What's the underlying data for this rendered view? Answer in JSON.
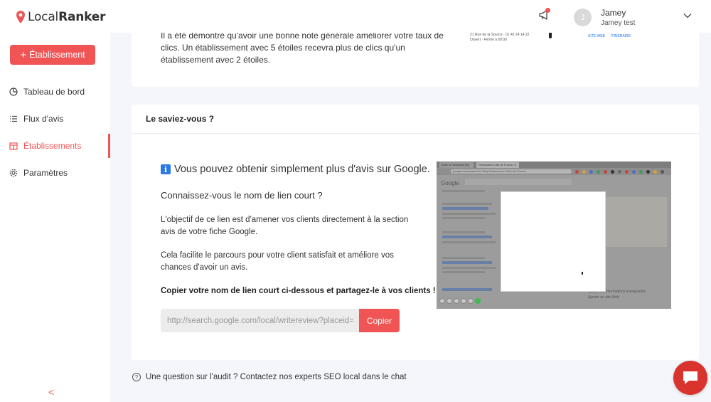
{
  "app": {
    "logo_text_light": "Local",
    "logo_text_bold": "Ranker",
    "brand_color": "#f05454"
  },
  "sidebar": {
    "add_button_label": "Établissement",
    "items": [
      {
        "label": "Tableau de bord",
        "icon": "pie-chart-icon",
        "active": false
      },
      {
        "label": "Flux d'avis",
        "icon": "list-icon",
        "active": false
      },
      {
        "label": "Établissements",
        "icon": "store-icon",
        "active": true
      },
      {
        "label": "Paramètres",
        "icon": "gear-icon",
        "active": false
      }
    ],
    "collapse_glyph": "<"
  },
  "header": {
    "avatar_initial": "J",
    "user_name": "Jamey",
    "user_sub": "Jamey test"
  },
  "card1": {
    "text": "Il a été démontré qu'avoir une bonne note générale améliorer votre taux de clics. Un établissement avec 5 étoiles recevra plus de clics qu'un établissement avec 2 étoiles.",
    "thumb_address": "21 Rue de la Source · 01 42 24 14 22",
    "thumb_open": "Ouvert · Ferme à 00:00",
    "thumb_site": "SITE WEB",
    "thumb_itin": "ITINÉRAIRE"
  },
  "card2": {
    "header": "Le saviez-vous ?",
    "info_glyph": "i",
    "title": "Vous pouvez obtenir simplement plus d'avis sur Google.",
    "question": "Connaissez-vous le nom de lien court ?",
    "paragraph1": "L'objectif de ce lien est d'amener vos clients directement à la section avis de votre fiche Google.",
    "paragraph2": "Cela facilite le parcours pour votre client satisfait et améliore vos chances d'avoir un avis.",
    "cta": "Copier votre nom de lien court ci-dessous et partagez-le à vos clients !",
    "link_value": "http://search.google.com/local/writereview?placeid=C",
    "copy_label": "Copier"
  },
  "preview": {
    "tab1": "Brille de réception (M) · alexm",
    "tab2": "Restaurant Café de France, 8 ·",
    "url": "google.com/search?hl=fr&q=Restaurant+Café+de+France",
    "google_label": "Google",
    "right_text_1": "Ajouter les informations manquantes",
    "right_text_2": "Ajouter un site Web"
  },
  "footer": {
    "help_text": "Une question sur l'audit ? Contactez nos experts SEO local dans le chat"
  }
}
